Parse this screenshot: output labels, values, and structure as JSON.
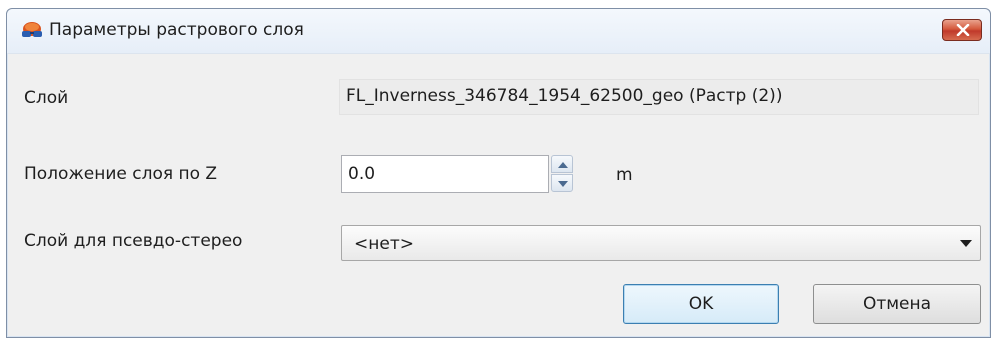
{
  "window": {
    "title": "Параметры растрового слоя",
    "app_icon": "stereo-glasses-icon",
    "close_icon": "close-icon",
    "close_color": "#c0392b"
  },
  "form": {
    "layer": {
      "label": "Слой",
      "value": "FL_Inverness_346784_1954_62500_geo (Растр (2))"
    },
    "z_position": {
      "label": "Положение слоя по Z",
      "value": "0.0",
      "unit": "m",
      "up_icon": "spin-up-icon",
      "down_icon": "spin-down-icon"
    },
    "pseudo_stereo": {
      "label": "Слой для псевдо-стерео",
      "selected": "<нет>",
      "arrow_icon": "chevron-down-icon"
    }
  },
  "buttons": {
    "ok": "OK",
    "cancel": "Отмена"
  }
}
